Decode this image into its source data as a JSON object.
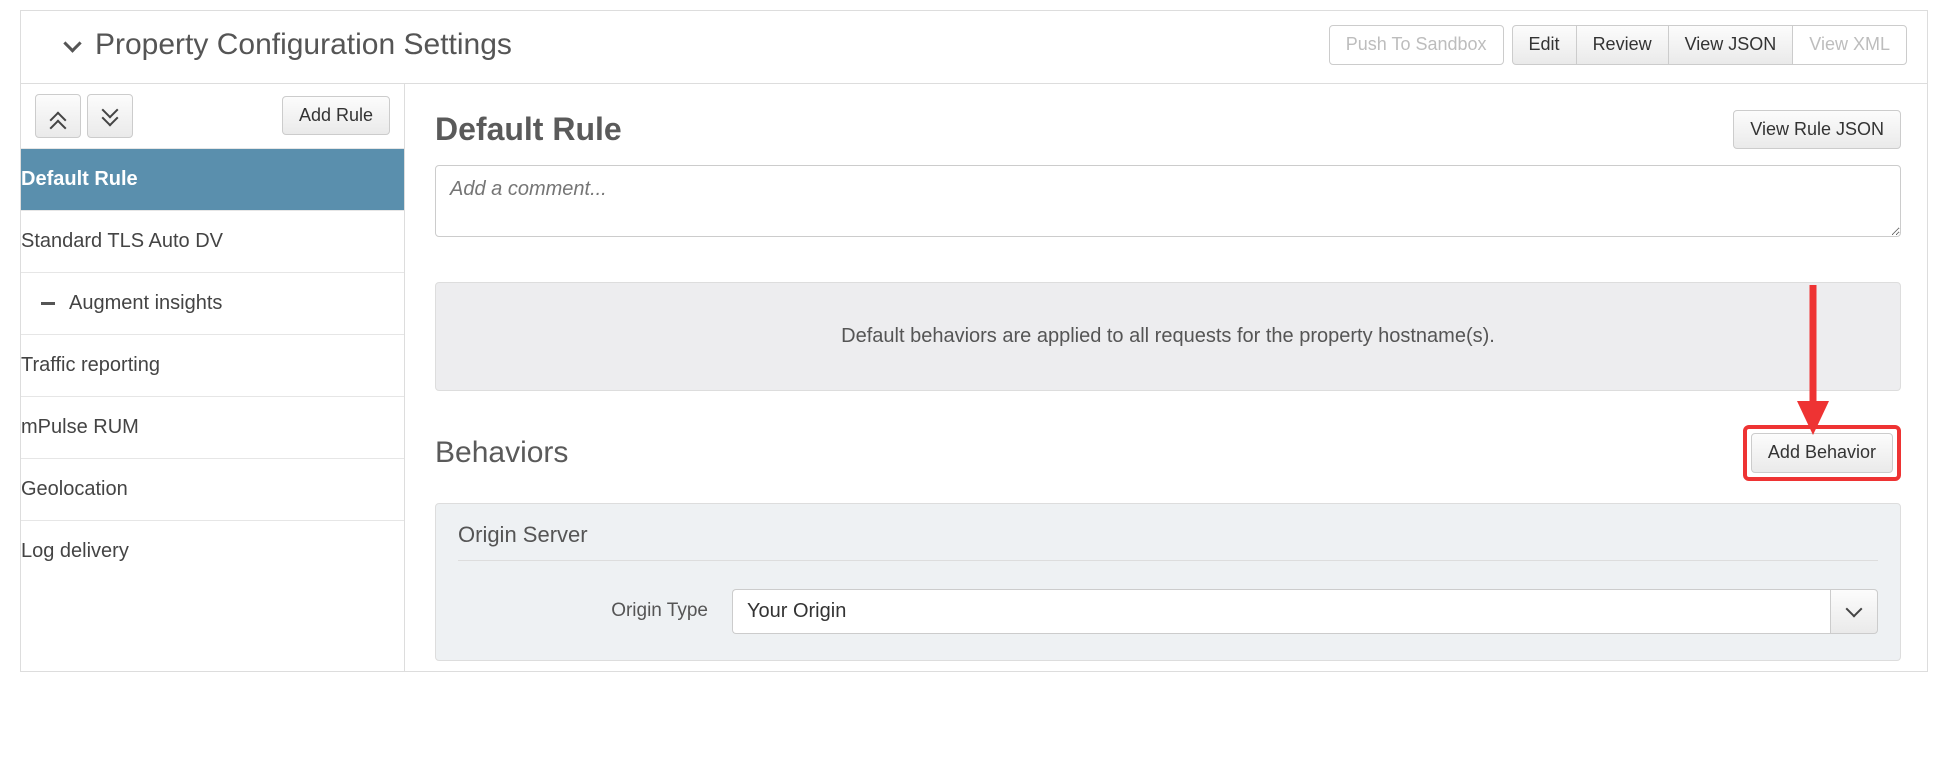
{
  "header": {
    "title": "Property Configuration Settings",
    "push_sandbox": "Push To Sandbox",
    "edit": "Edit",
    "review": "Review",
    "view_json": "View JSON",
    "view_xml": "View XML"
  },
  "sidebar": {
    "add_rule": "Add Rule",
    "rules": [
      {
        "label": "Default Rule",
        "depth": 0,
        "active": true,
        "collapsible": false
      },
      {
        "label": "Standard TLS Auto DV",
        "depth": 1,
        "active": false,
        "collapsible": false
      },
      {
        "label": "Augment insights",
        "depth": 1,
        "active": false,
        "collapsible": true,
        "expanded": true
      },
      {
        "label": "Traffic reporting",
        "depth": 2,
        "active": false,
        "collapsible": false
      },
      {
        "label": "mPulse RUM",
        "depth": 2,
        "active": false,
        "collapsible": false
      },
      {
        "label": "Geolocation",
        "depth": 2,
        "active": false,
        "collapsible": false
      },
      {
        "label": "Log delivery",
        "depth": 2,
        "active": false,
        "collapsible": false
      }
    ]
  },
  "main": {
    "title": "Default Rule",
    "view_rule_json": "View Rule JSON",
    "comment_placeholder": "Add a comment...",
    "info_banner": "Default behaviors are applied to all requests for the property hostname(s).",
    "behaviors_title": "Behaviors",
    "add_behavior": "Add Behavior",
    "behavior": {
      "name": "Origin Server",
      "origin_type_label": "Origin Type",
      "origin_type_value": "Your Origin"
    }
  }
}
